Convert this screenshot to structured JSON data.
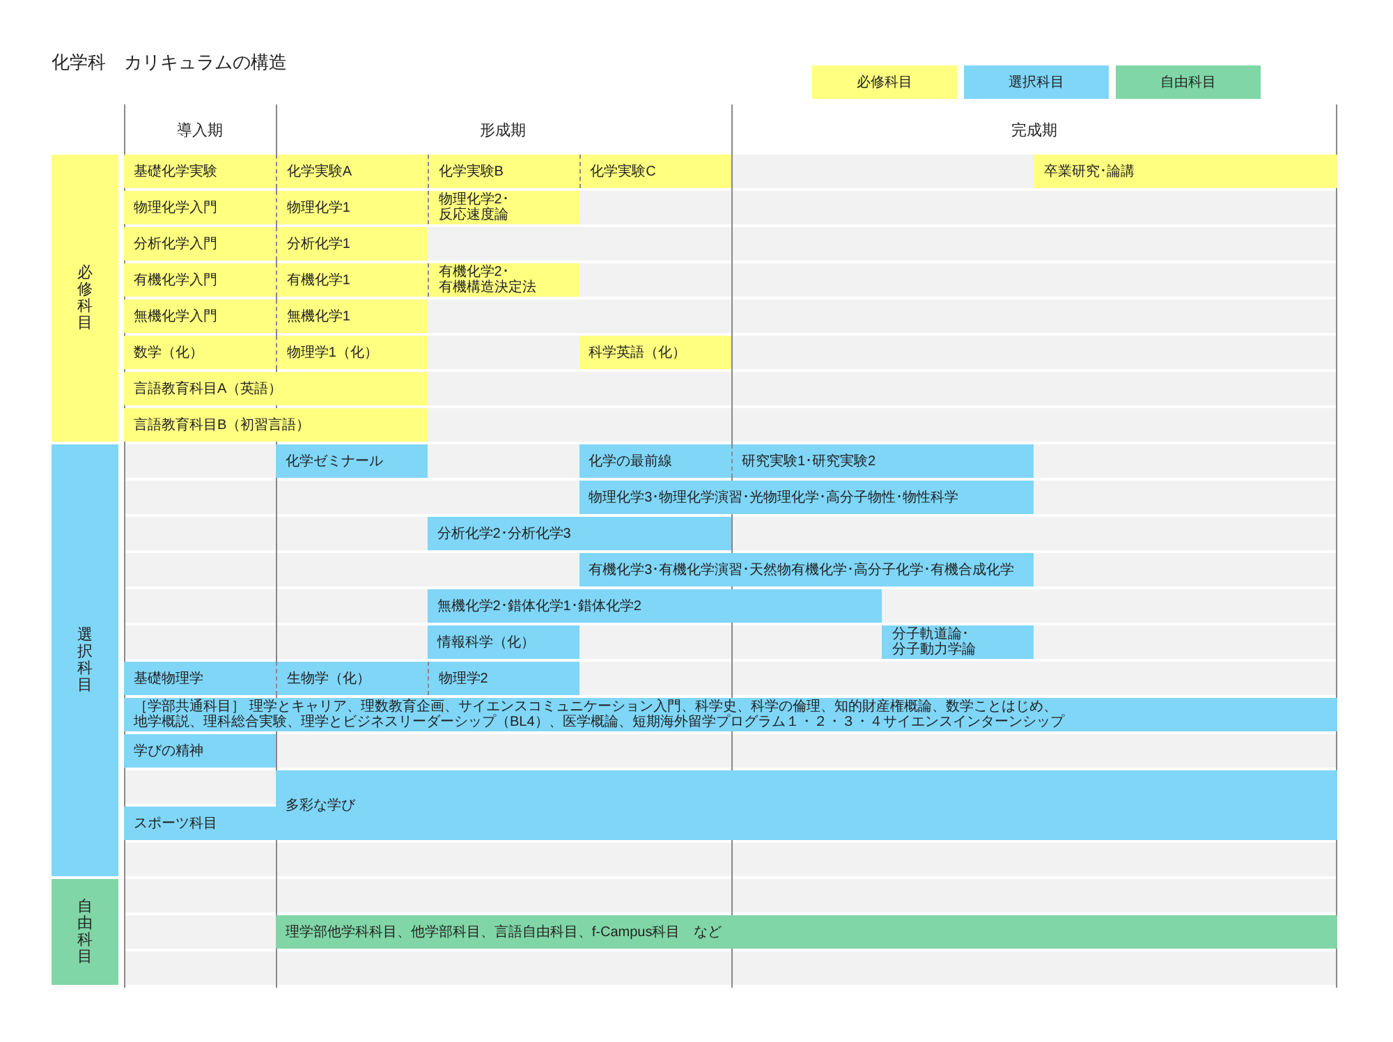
{
  "title": "化学科　カリキュラムの構造",
  "legend": [
    {
      "label": "必修科目",
      "kind": "required",
      "color": "#ffff80"
    },
    {
      "label": "選択科目",
      "kind": "elective",
      "color": "#7fd6f7"
    },
    {
      "label": "自由科目",
      "kind": "free",
      "color": "#80d6a6"
    }
  ],
  "periods": [
    {
      "label": "導入期"
    },
    {
      "label": "形成期",
      "colspan": 3
    },
    {
      "label": "完成期",
      "colspan": 4
    }
  ],
  "groups": [
    {
      "label": "必修科目",
      "kind": "required",
      "rows": [
        {
          "cells": [
            {
              "text": "基礎化学実験"
            },
            {
              "text": "化学実験A"
            },
            {
              "text": "化学実験B"
            },
            {
              "text": "化学実験C"
            },
            "",
            "",
            {
              "text": "卒業研究･論講",
              "colspan": 2
            }
          ]
        },
        {
          "cells": [
            {
              "text": "物理化学入門"
            },
            {
              "text": "物理化学1"
            },
            {
              "lines": [
                "物理化学2･",
                "反応速度論"
              ]
            }
          ]
        },
        {
          "cells": [
            {
              "text": "分析化学入門"
            },
            {
              "text": "分析化学1"
            }
          ]
        },
        {
          "cells": [
            {
              "text": "有機化学入門"
            },
            {
              "text": "有機化学1"
            },
            {
              "lines": [
                "有機化学2･",
                "有機構造決定法"
              ]
            }
          ]
        },
        {
          "cells": [
            {
              "text": "無機化学入門"
            },
            {
              "text": "無機化学1"
            }
          ]
        },
        {
          "cells": [
            {
              "text": "数学（化）"
            },
            {
              "text": "物理学1（化）"
            },
            "",
            {
              "text": "科学英語（化）"
            }
          ]
        },
        {
          "cells": [
            {
              "text": "言語教育科目A（英語）",
              "colspan": 2
            }
          ]
        },
        {
          "cells": [
            {
              "text": "言語教育科目B（初習言語）",
              "colspan": 2
            }
          ]
        }
      ]
    },
    {
      "label": "選択科目",
      "kind": "elective",
      "rows": [
        {
          "cells": [
            "",
            {
              "text": "化学ゼミナール"
            },
            "",
            {
              "text": "化学の最前線"
            },
            {
              "text": "研究実験1･研究実験2",
              "colspan": 2
            }
          ]
        },
        {
          "cells": [
            "",
            "",
            "",
            {
              "text": "物理化学3･物理化学演習･光物理化学･高分子物性･物性科学",
              "colspan": 3
            }
          ]
        },
        {
          "cells": [
            "",
            "",
            {
              "text": "分析化学2･分析化学3",
              "colspan": 2
            }
          ]
        },
        {
          "cells": [
            "",
            "",
            "",
            {
              "text": "有機化学3･有機化学演習･天然物有機化学･高分子化学･有機合成化学",
              "colspan": 3
            }
          ]
        },
        {
          "cells": [
            "",
            "",
            {
              "text": "無機化学2･錯体化学1･錯体化学2",
              "colspan": 3
            }
          ]
        },
        {
          "cells": [
            "",
            "",
            {
              "text": "情報科学（化）"
            },
            "",
            "",
            {
              "lines": [
                "分子軌道論･",
                "分子動力学論"
              ]
            }
          ]
        },
        {
          "cells": [
            {
              "text": "基礎物理学"
            },
            {
              "text": "生物学（化）"
            },
            {
              "text": "物理学2"
            }
          ]
        },
        {
          "cells": [
            {
              "lines": [
                "［学部共通科目］ 理学とキャリア、理数教育企画、サイエンスコミュニケーション入門、科学史、科学の倫理、知的財産権概論、数学ことはじめ、",
                "地学概説、理科総合実験、理学とビジネスリーダーシップ（BL4）、医学概論、短期海外留学プログラム１・２・３・４サイエンスインターンシップ"
              ],
              "colspan": 8
            }
          ]
        },
        {
          "cells": [
            {
              "text": "学びの精神"
            }
          ]
        },
        {
          "cells": [
            "",
            {
              "text": "多彩な学び",
              "colspan": 7,
              "rowspan": 2
            }
          ]
        },
        {
          "cells": [
            {
              "text": "スポーツ科目"
            }
          ]
        },
        {}
      ]
    },
    {
      "label": "自由科目",
      "kind": "free",
      "rows": [
        {},
        {
          "cells": [
            "",
            {
              "text": "理学部他学科科目、他学部科目、言語自由科目、f-Campus科目　など",
              "colspan": 7
            }
          ]
        },
        {}
      ]
    }
  ]
}
